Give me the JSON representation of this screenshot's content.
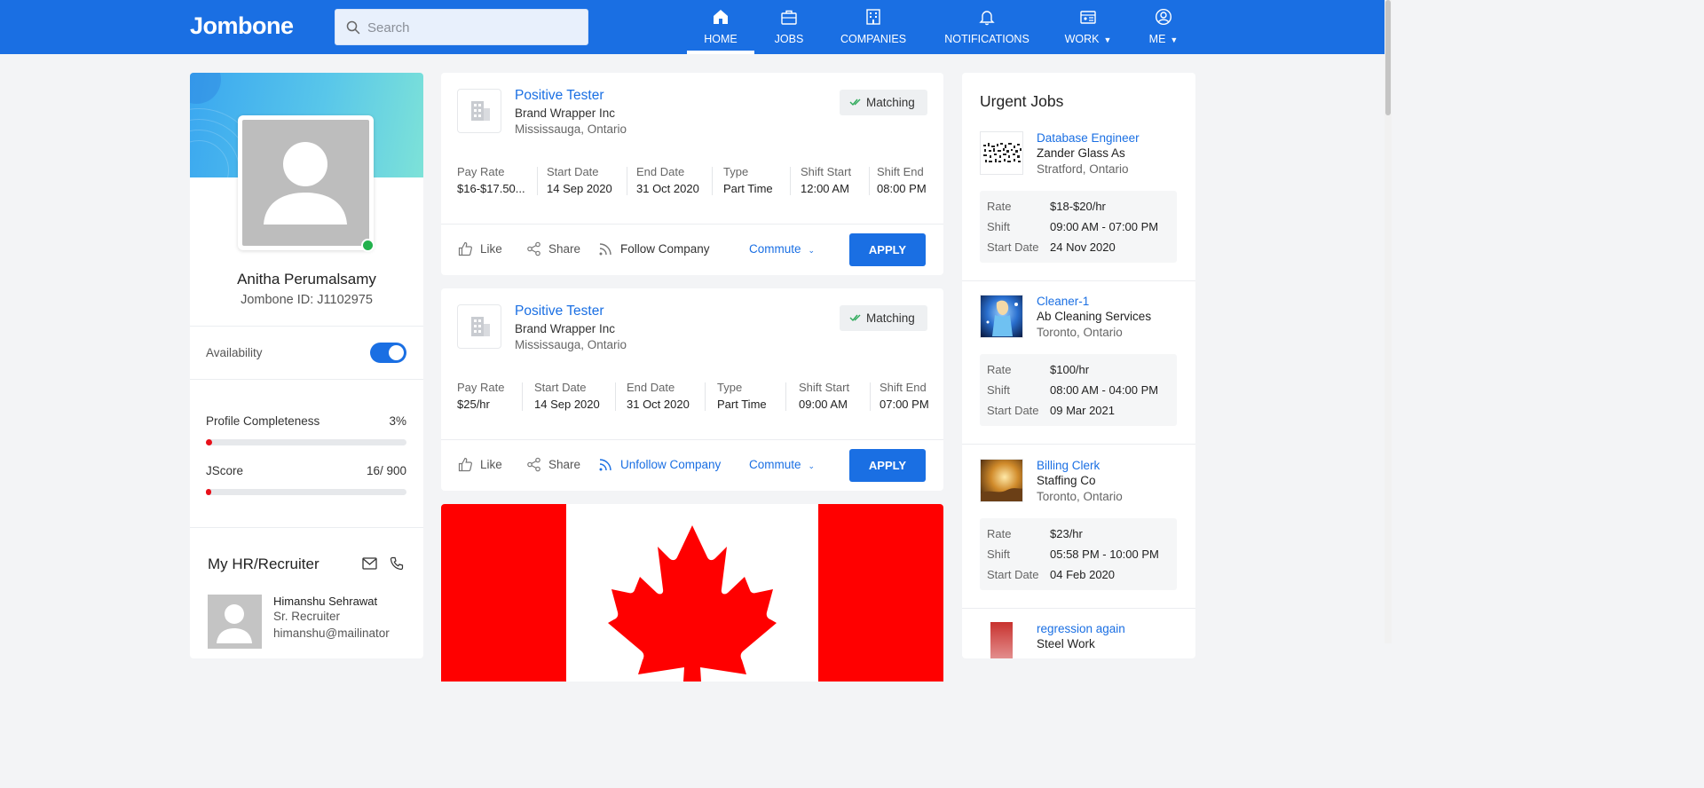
{
  "app": {
    "logo": "Jombone",
    "search_placeholder": "Search",
    "brand_color": "#1a6fe3",
    "nav": [
      {
        "label": "HOME",
        "icon": "home-icon",
        "active": true
      },
      {
        "label": "JOBS",
        "icon": "briefcase-icon"
      },
      {
        "label": "COMPANIES",
        "icon": "building-icon"
      },
      {
        "label": "NOTIFICATIONS",
        "icon": "bell-icon"
      },
      {
        "label": "WORK",
        "icon": "id-card-icon",
        "dropdown": true
      },
      {
        "label": "ME",
        "icon": "user-circle-icon",
        "dropdown": true
      }
    ]
  },
  "profile": {
    "name": "Anitha Perumalsamy",
    "id_text": "Jombone ID: J1102975",
    "availability_label": "Availability",
    "availability_on": true,
    "completeness_label": "Profile Completeness",
    "completeness_value": "3%",
    "completeness_fraction": 0.03,
    "jscore_label": "JScore",
    "jscore_value": "16/ 900",
    "jscore_fraction": 0.018,
    "online_color": "#22b14c"
  },
  "recruiter": {
    "title": "My HR/Recruiter",
    "name": "Himanshu Sehrawat",
    "role": "Sr. Recruiter",
    "email": "himanshu@mailinator"
  },
  "jobs": [
    {
      "title": "Positive Tester",
      "company": "Brand Wrapper Inc",
      "location": "Mississauga, Ontario",
      "badge": "Matching",
      "details": [
        {
          "label": "Pay Rate",
          "value": "$16-$17.50..."
        },
        {
          "label": "Start Date",
          "value": "14 Sep 2020"
        },
        {
          "label": "End Date",
          "value": "31 Oct 2020"
        },
        {
          "label": "Type",
          "value": "Part Time"
        },
        {
          "label": "Shift Start",
          "value": "12:00 AM"
        },
        {
          "label": "Shift End",
          "value": "08:00 PM"
        }
      ],
      "like": "Like",
      "share": "Share",
      "follow": "Follow Company",
      "following": false,
      "commute": "Commute",
      "apply": "APPLY"
    },
    {
      "title": "Positive Tester",
      "company": "Brand Wrapper Inc",
      "location": "Mississauga, Ontario",
      "badge": "Matching",
      "details": [
        {
          "label": "Pay Rate",
          "value": "$25/hr"
        },
        {
          "label": "Start Date",
          "value": "14 Sep 2020"
        },
        {
          "label": "End Date",
          "value": "31 Oct 2020"
        },
        {
          "label": "Type",
          "value": "Part Time"
        },
        {
          "label": "Shift Start",
          "value": "09:00 AM"
        },
        {
          "label": "Shift End",
          "value": "07:00 PM"
        }
      ],
      "like": "Like",
      "share": "Share",
      "follow": "Unfollow Company",
      "following": true,
      "commute": "Commute",
      "apply": "APPLY"
    }
  ],
  "flag_colors": {
    "red": "#ff0000",
    "white": "#ffffff"
  },
  "urgent": {
    "title": "Urgent Jobs",
    "items": [
      {
        "title": "Database Engineer",
        "company": "Zander Glass As",
        "location": "Stratford, Ontario",
        "rate_label": "Rate",
        "rate": "$18-$20/hr",
        "shift_label": "Shift",
        "shift": "09:00 AM - 07:00 PM",
        "start_label": "Start Date",
        "start": "24 Nov 2020"
      },
      {
        "title": "Cleaner-1",
        "company": "Ab Cleaning Services",
        "location": "Toronto, Ontario",
        "rate_label": "Rate",
        "rate": "$100/hr",
        "shift_label": "Shift",
        "shift": "08:00 AM - 04:00 PM",
        "start_label": "Start Date",
        "start": "09 Mar 2021"
      },
      {
        "title": "Billing Clerk",
        "company": "Staffing Co",
        "location": "Toronto, Ontario",
        "rate_label": "Rate",
        "rate": "$23/hr",
        "shift_label": "Shift",
        "shift": "05:58 PM - 10:00 PM",
        "start_label": "Start Date",
        "start": "04 Feb 2020"
      },
      {
        "title": "regression again",
        "company": "Steel Work",
        "location": ""
      }
    ]
  }
}
